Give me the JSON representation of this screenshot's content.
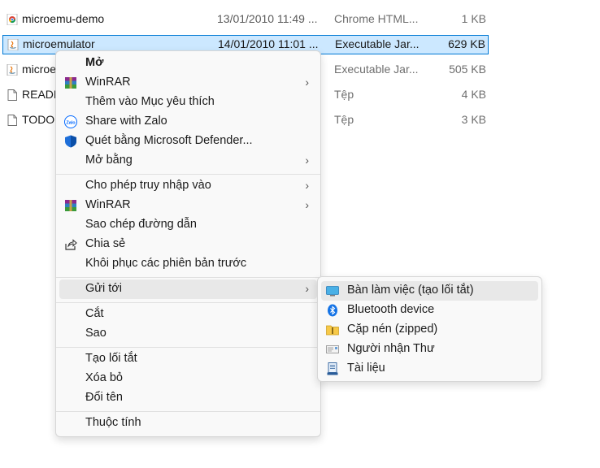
{
  "files": [
    {
      "name": "microemu-demo",
      "date": "13/01/2010 11:49 ...",
      "type": "Chrome HTML...",
      "size": "1 KB",
      "icon": "chrome-icon"
    },
    {
      "name": "microemulator",
      "date": "14/01/2010 11:01 ...",
      "type": "Executable Jar...",
      "size": "629 KB",
      "icon": "java-icon"
    },
    {
      "name": "microe",
      "date": "",
      "type": "Executable Jar...",
      "size": "505 KB",
      "icon": "java-icon"
    },
    {
      "name": "READM",
      "date": "",
      "type": "Tệp",
      "size": "4 KB",
      "icon": "file-icon"
    },
    {
      "name": "TODO",
      "date": "",
      "type": "Tệp",
      "size": "3 KB",
      "icon": "file-icon"
    }
  ],
  "context_menu": {
    "open": "Mở",
    "winrar1": "WinRAR",
    "add_favorites": "Thêm vào Mục yêu thích",
    "share_zalo": "Share with Zalo",
    "defender": "Quét bằng Microsoft Defender...",
    "open_with": "Mở bằng",
    "grant_access": "Cho phép truy nhập vào",
    "winrar2": "WinRAR",
    "copy_path": "Sao chép đường dẫn",
    "share": "Chia sẻ",
    "restore": "Khôi phục các phiên bản trước",
    "send_to": "Gửi tới",
    "cut": "Cắt",
    "copy": "Sao",
    "create_shortcut": "Tạo lối tắt",
    "delete": "Xóa bỏ",
    "rename": "Đổi tên",
    "properties": "Thuộc tính"
  },
  "send_to_menu": {
    "desktop": "Bàn làm việc (tạo lối tắt)",
    "bluetooth": "Bluetooth device",
    "zip": "Cặp nén (zipped)",
    "mail": "Người nhận Thư",
    "documents": "Tài liệu"
  },
  "icons": {
    "zalo_text": "Zalo"
  },
  "colors": {
    "selection_bg": "#cce8ff",
    "selection_border": "#0078d4",
    "menu_bg": "#f9f9f9",
    "highlight": "#e8e8e8"
  }
}
